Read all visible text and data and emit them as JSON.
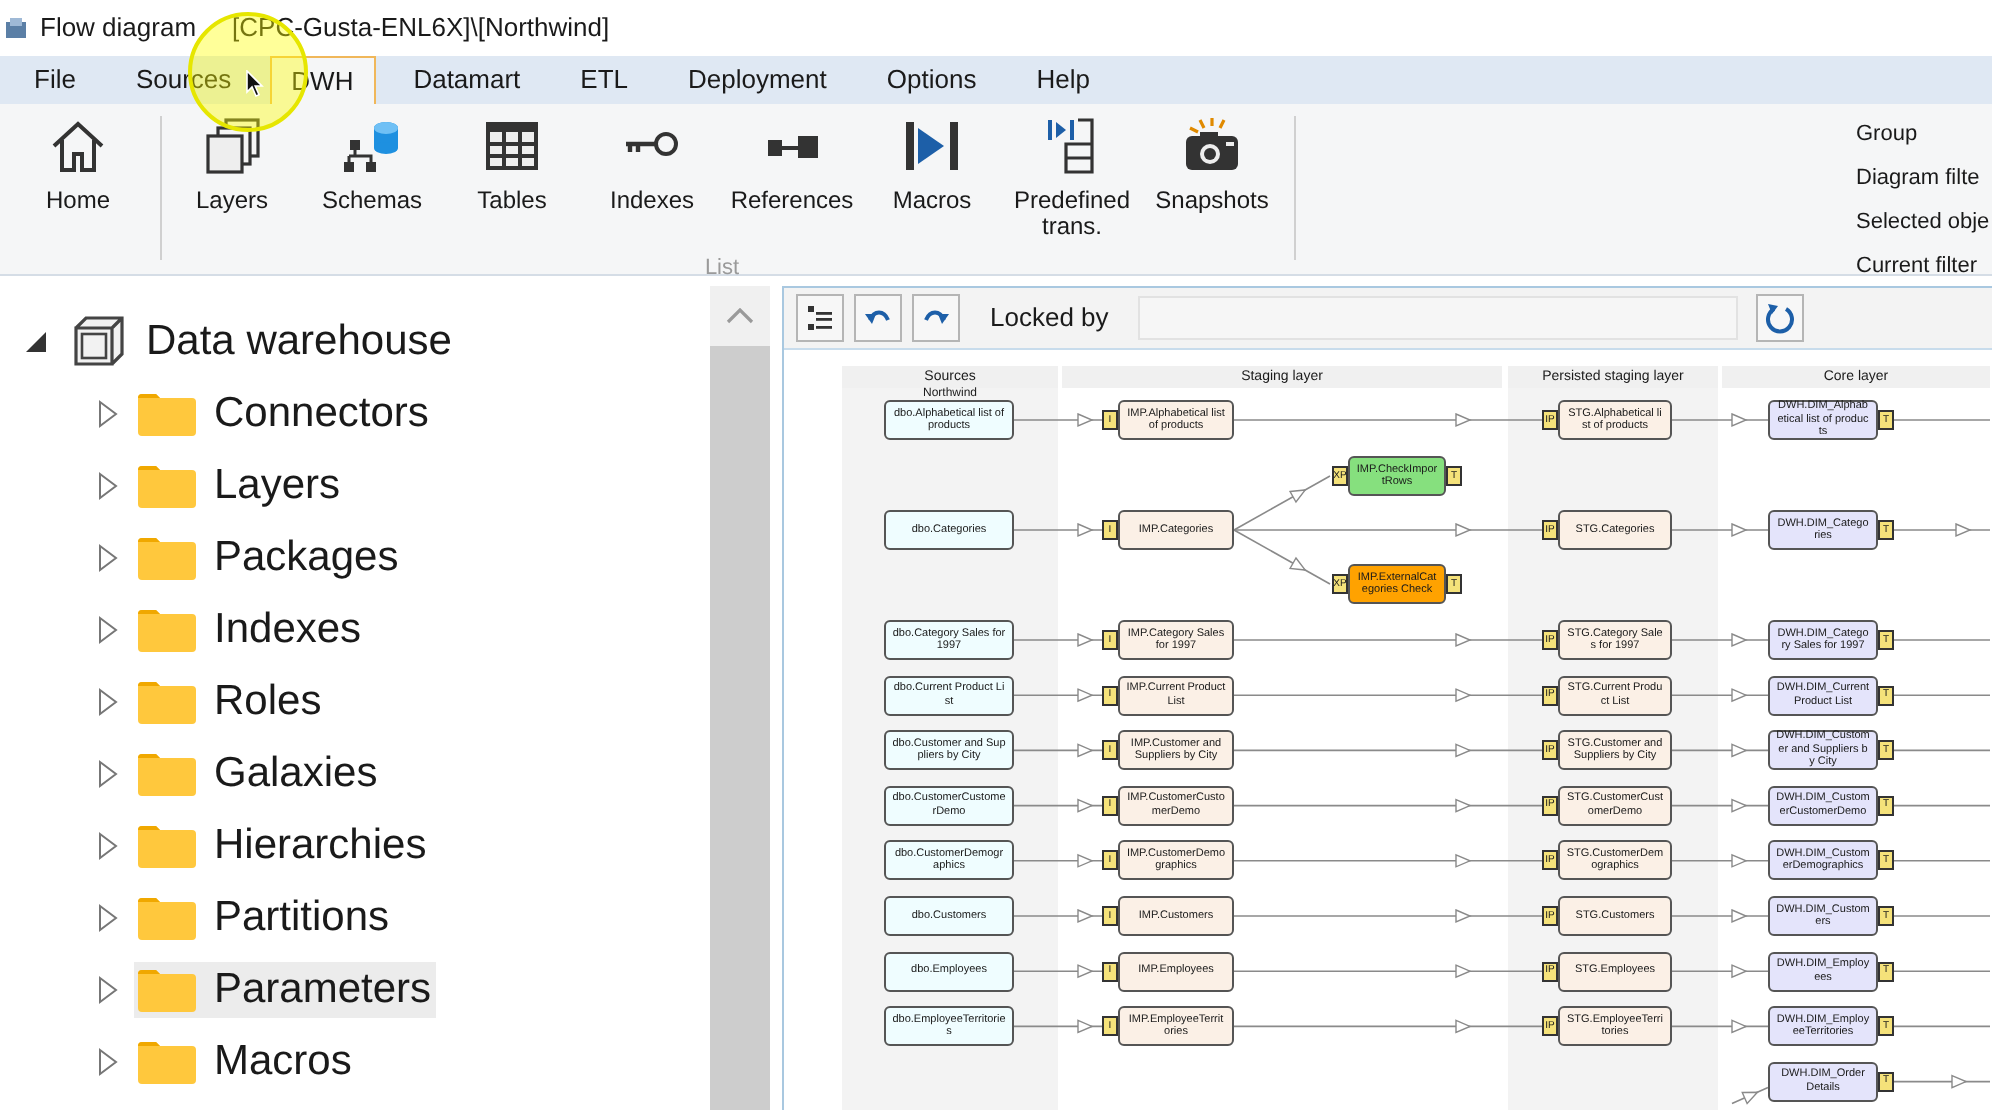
{
  "window": {
    "title": "Flow diagram",
    "path": "[CPC-Gusta-ENL6X]\\[Northwind]"
  },
  "menu": [
    {
      "label": "File",
      "selected": false
    },
    {
      "label": "Sources",
      "selected": false
    },
    {
      "label": "DWH",
      "selected": true
    },
    {
      "label": "Datamart",
      "selected": false
    },
    {
      "label": "ETL",
      "selected": false
    },
    {
      "label": "Deployment",
      "selected": false
    },
    {
      "label": "Options",
      "selected": false
    },
    {
      "label": "Help",
      "selected": false
    }
  ],
  "ribbon": {
    "home": {
      "label": "Home",
      "kind": "home"
    },
    "group": {
      "label": "List",
      "buttons": [
        {
          "label": "Layers",
          "kind": "layers"
        },
        {
          "label": "Schemas",
          "kind": "schemas"
        },
        {
          "label": "Tables",
          "kind": "tables"
        },
        {
          "label": "Indexes",
          "kind": "indexes"
        },
        {
          "label": "References",
          "kind": "references"
        },
        {
          "label": "Macros",
          "kind": "macros"
        },
        {
          "label": "Predefined trans.",
          "kind": "predefined"
        },
        {
          "label": "Snapshots",
          "kind": "snapshots"
        }
      ]
    },
    "side_options": [
      "Group",
      "Diagram filte",
      "Selected obje",
      "Current filter"
    ]
  },
  "tree": {
    "label": "Data warehouse",
    "expanded": true,
    "children": [
      {
        "label": "Connectors",
        "selected": false
      },
      {
        "label": "Layers",
        "selected": false
      },
      {
        "label": "Packages",
        "selected": false
      },
      {
        "label": "Indexes",
        "selected": false
      },
      {
        "label": "Roles",
        "selected": false
      },
      {
        "label": "Galaxies",
        "selected": false
      },
      {
        "label": "Hierarchies",
        "selected": false
      },
      {
        "label": "Partitions",
        "selected": false
      },
      {
        "label": "Parameters",
        "selected": true
      },
      {
        "label": "Macros",
        "selected": false
      }
    ]
  },
  "diagram_toolbar": {
    "locked_by_label": "Locked by"
  },
  "diagram": {
    "lanes": [
      {
        "title": "Sources",
        "subtitle": "Northwind"
      },
      {
        "title": "Staging layer"
      },
      {
        "title": "Persisted staging layer"
      },
      {
        "title": "Core layer"
      }
    ],
    "rows": [
      {
        "source": "dbo.Alphabetical list of products",
        "staging": {
          "text": "IMP.Alphabetical list of products",
          "marker": "I"
        },
        "persisted": {
          "text": "STG.Alphabetical list of products",
          "marker": "IP"
        },
        "core": {
          "text": "DWH.DIM_Alphabetical list of products",
          "marker": "T"
        }
      },
      {
        "source": "dbo.Categories",
        "staging": {
          "text": "IMP.Categories",
          "marker": "I"
        },
        "persisted": {
          "text": "STG.Categories",
          "marker": "IP"
        },
        "core": {
          "text": "DWH.DIM_Categories",
          "marker": "T"
        },
        "checks": [
          {
            "text": "IMP.CheckImportRows",
            "marker": "XP",
            "end_marker": "T",
            "color": "#86e07e"
          },
          {
            "text": "IMP.ExternalCategories Check",
            "marker": "XP",
            "end_marker": "T",
            "color": "#ffa200"
          }
        ]
      },
      {
        "source": "dbo.Category Sales for 1997",
        "staging": {
          "text": "IMP.Category Sales for 1997",
          "marker": "I"
        },
        "persisted": {
          "text": "STG.Category Sales for 1997",
          "marker": "IP"
        },
        "core": {
          "text": "DWH.DIM_Category Sales for 1997",
          "marker": "T"
        }
      },
      {
        "source": "dbo.Current Product List",
        "staging": {
          "text": "IMP.Current Product List",
          "marker": "I"
        },
        "persisted": {
          "text": "STG.Current Product List",
          "marker": "IP"
        },
        "core": {
          "text": "DWH.DIM_Current Product List",
          "marker": "T"
        }
      },
      {
        "source": "dbo.Customer and Suppliers by City",
        "staging": {
          "text": "IMP.Customer and Suppliers by City",
          "marker": "I"
        },
        "persisted": {
          "text": "STG.Customer and Suppliers by City",
          "marker": "IP"
        },
        "core": {
          "text": "DWH.DIM_Customer and Suppliers by City",
          "marker": "T"
        }
      },
      {
        "source": "dbo.CustomerCustomerDemo",
        "staging": {
          "text": "IMP.CustomerCustomerDemo",
          "marker": "I"
        },
        "persisted": {
          "text": "STG.CustomerCustomerDemo",
          "marker": "IP"
        },
        "core": {
          "text": "DWH.DIM_CustomerCustomerDemo",
          "marker": "T"
        }
      },
      {
        "source": "dbo.CustomerDemographics",
        "staging": {
          "text": "IMP.CustomerDemographics",
          "marker": "I"
        },
        "persisted": {
          "text": "STG.CustomerDemographics",
          "marker": "IP"
        },
        "core": {
          "text": "DWH.DIM_CustomerDemographics",
          "marker": "T"
        }
      },
      {
        "source": "dbo.Customers",
        "staging": {
          "text": "IMP.Customers",
          "marker": "I"
        },
        "persisted": {
          "text": "STG.Customers",
          "marker": "IP"
        },
        "core": {
          "text": "DWH.DIM_Customers",
          "marker": "T"
        }
      },
      {
        "source": "dbo.Employees",
        "staging": {
          "text": "IMP.Employees",
          "marker": "I"
        },
        "persisted": {
          "text": "STG.Employees",
          "marker": "IP"
        },
        "core": {
          "text": "DWH.DIM_Employees",
          "marker": "T"
        }
      },
      {
        "source": "dbo.EmployeeTerritories",
        "staging": {
          "text": "IMP.EmployeeTerritories",
          "marker": "I"
        },
        "persisted": {
          "text": "STG.EmployeeTerritories",
          "marker": "IP"
        },
        "core": {
          "text": "DWH.DIM_EmployeeTerritories",
          "marker": "T"
        }
      },
      {
        "core": {
          "text": "DWH.DIM_Order Details",
          "marker": "T"
        }
      }
    ]
  }
}
